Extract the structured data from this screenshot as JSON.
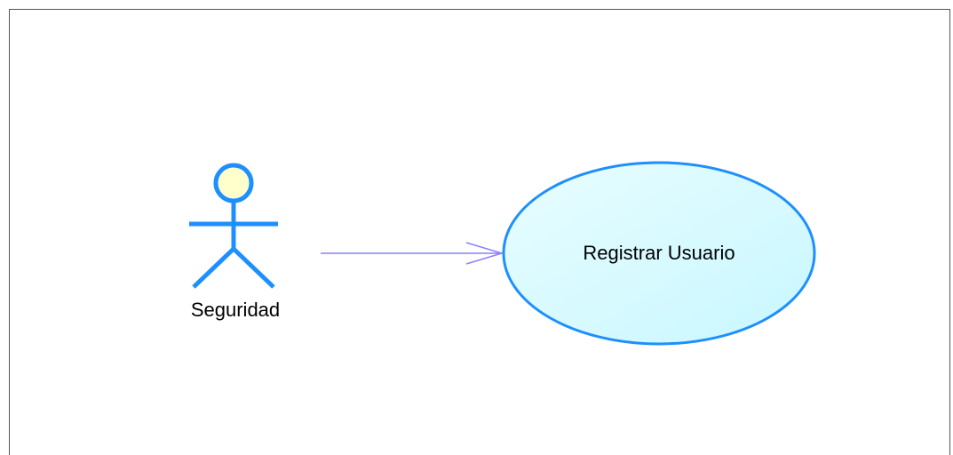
{
  "diagram": {
    "type": "use-case",
    "actor": {
      "name": "Seguridad",
      "icon": "stick-figure-actor-icon",
      "head_fill": "#ffffcc",
      "stroke": "#1e8fff"
    },
    "use_case": {
      "name": "Registrar Usuario",
      "fill_start": "#e8fdff",
      "fill_end": "#c8f7ff",
      "stroke": "#1e8fff"
    },
    "association": {
      "from": "Seguridad",
      "to": "Registrar Usuario",
      "stroke": "#8b80ff",
      "arrowhead": "open"
    }
  }
}
